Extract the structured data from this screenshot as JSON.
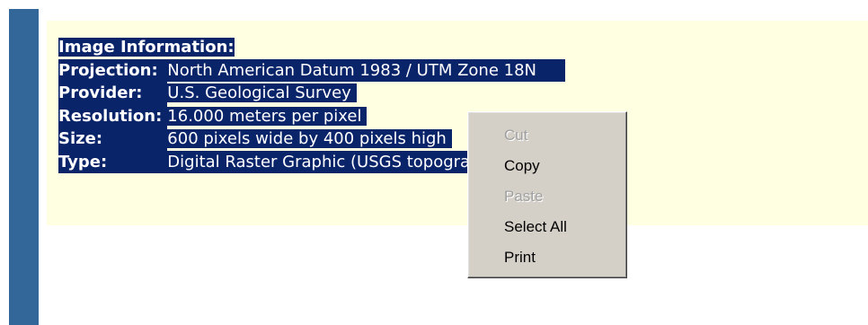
{
  "info": {
    "title": "Image Information:",
    "rows": [
      {
        "label": "Projection:",
        "value": "North American Datum 1983 / UTM Zone 18N"
      },
      {
        "label": "Provider:",
        "value": "U.S. Geological Survey"
      },
      {
        "label": "Resolution:",
        "value": "16.000 meters per pixel"
      },
      {
        "label": "Size:",
        "value": "600 pixels wide by 400 pixels high"
      },
      {
        "label": "Type:",
        "value": "Digital Raster Graphic (USGS topographic maps)"
      }
    ]
  },
  "context_menu": {
    "items": [
      {
        "label": "Cut",
        "enabled": false
      },
      {
        "label": "Copy",
        "enabled": true
      },
      {
        "label": "Paste",
        "enabled": false
      },
      {
        "label": "Select All",
        "enabled": true
      },
      {
        "label": "Print",
        "enabled": true
      }
    ]
  },
  "colors": {
    "left_bar": "#336699",
    "panel_background": "#ffffe1",
    "selection_highlight": "#0a246a",
    "menu_background": "#d4d0c8"
  }
}
